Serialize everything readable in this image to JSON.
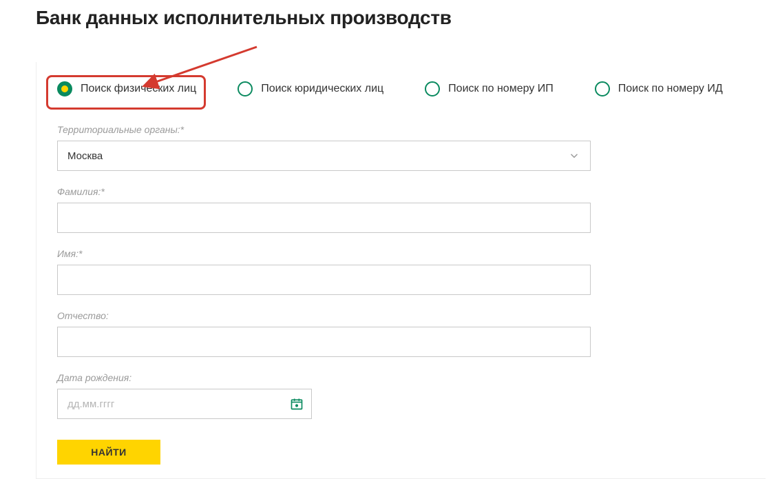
{
  "page": {
    "title": "Банк данных исполнительных производств"
  },
  "search_tabs": {
    "options": [
      {
        "label": "Поиск физических лиц",
        "selected": true
      },
      {
        "label": "Поиск юридических лиц",
        "selected": false
      },
      {
        "label": "Поиск по номеру ИП",
        "selected": false
      },
      {
        "label": "Поиск по номеру ИД",
        "selected": false
      }
    ]
  },
  "form": {
    "territory": {
      "label": "Территориальные органы:*",
      "value": "Москва"
    },
    "lastname": {
      "label": "Фамилия:*",
      "value": ""
    },
    "firstname": {
      "label": "Имя:*",
      "value": ""
    },
    "patronymic": {
      "label": "Отчество:",
      "value": ""
    },
    "birthdate": {
      "label": "Дата рождения:",
      "placeholder": "дд.мм.гггг",
      "value": ""
    },
    "submit_label": "НАЙТИ"
  }
}
